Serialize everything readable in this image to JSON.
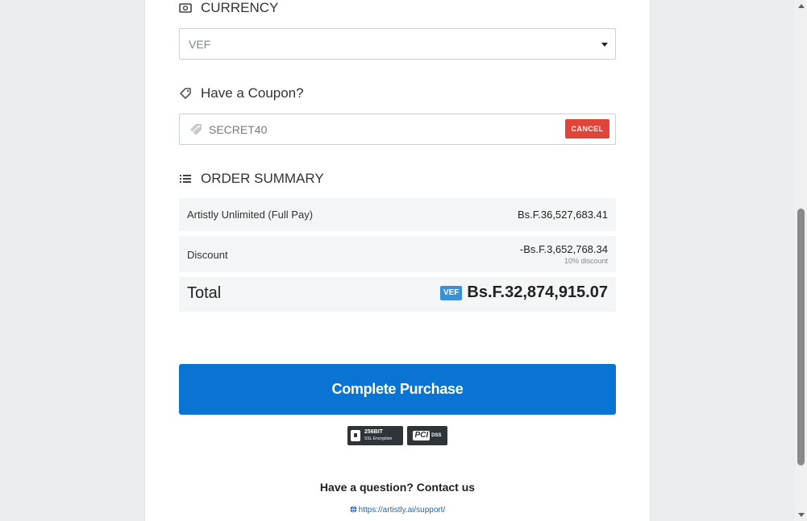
{
  "currency": {
    "title": "CURRENCY",
    "icon": "money-icon",
    "selected": "VEF"
  },
  "coupon": {
    "title": "Have a Coupon?",
    "icon": "tag-icon",
    "code": "SECRET40",
    "cancel_label": "CANCEL"
  },
  "order_summary": {
    "title": "ORDER SUMMARY",
    "icon": "list-icon",
    "item_label": "Artistly Unlimited (Full Pay)",
    "item_amount": "Bs.F.36,527,683.41",
    "discount_label": "Discount",
    "discount_amount": "-Bs.F.3,652,768.34",
    "discount_note": "10% discount",
    "total_label": "Total",
    "currency_badge": "VEF",
    "total_amount": "Bs.F.32,874,915.07"
  },
  "purchase_label": "Complete Purchase",
  "badges": {
    "ssl_line1": "256BIT",
    "ssl_line2": "SSL Encryption",
    "pci": "PCI",
    "dss": "DSS"
  },
  "support": {
    "question": "Have a question? Contact us",
    "link": "https://artistly.ai/support/"
  },
  "colors": {
    "accent": "#0a74d4",
    "cancel": "#e0453a",
    "badge": "#3b8fd6",
    "link": "#1f66b8"
  }
}
